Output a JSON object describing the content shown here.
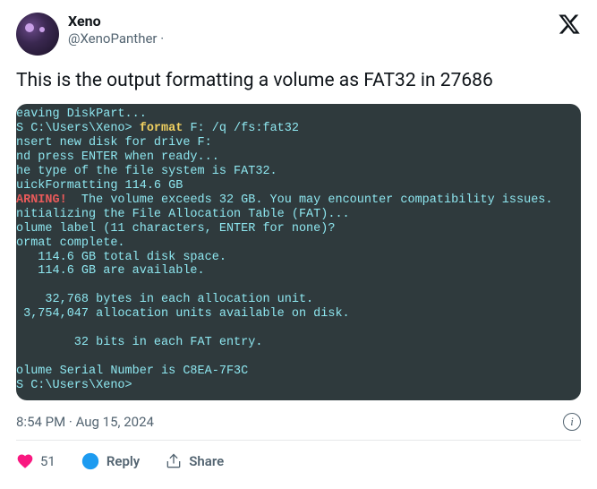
{
  "author": {
    "display_name": "Xeno",
    "handle": "@XenoPanther ·"
  },
  "tweet_text": "This is the output formatting a volume as FAT32 in 27686",
  "terminal": {
    "l1a": "eaving DiskPart...",
    "l2a": "S C:\\Users\\Xeno> ",
    "l2b": "format ",
    "l2c": "F: /q /fs:fat32",
    "l3": "nsert new disk for drive F:",
    "l4": "nd press ENTER when ready...",
    "l5": "he type of the file system is FAT32.",
    "l6": "uickFormatting 114.6 GB",
    "l7a": "ARNING!",
    "l7b": "  The volume exceeds 32 GB. You may encounter compatibility issues.",
    "l8": "nitializing the File Allocation Table (FAT)...",
    "l9": "olume label (11 characters, ENTER for none)?",
    "l10": "ormat complete.",
    "l11": "   114.6 GB total disk space.",
    "l12": "   114.6 GB are available.",
    "l13": "    32,768 bytes in each allocation unit.",
    "l14": " 3,754,047 allocation units available on disk.",
    "l15": "        32 bits in each FAT entry.",
    "l16": "olume Serial Number is C8EA-7F3C",
    "l17": "S C:\\Users\\Xeno>"
  },
  "timestamp": "8:54 PM · Aug 15, 2024",
  "actions": {
    "like_count": "51",
    "reply_label": "Reply",
    "share_label": "Share"
  }
}
